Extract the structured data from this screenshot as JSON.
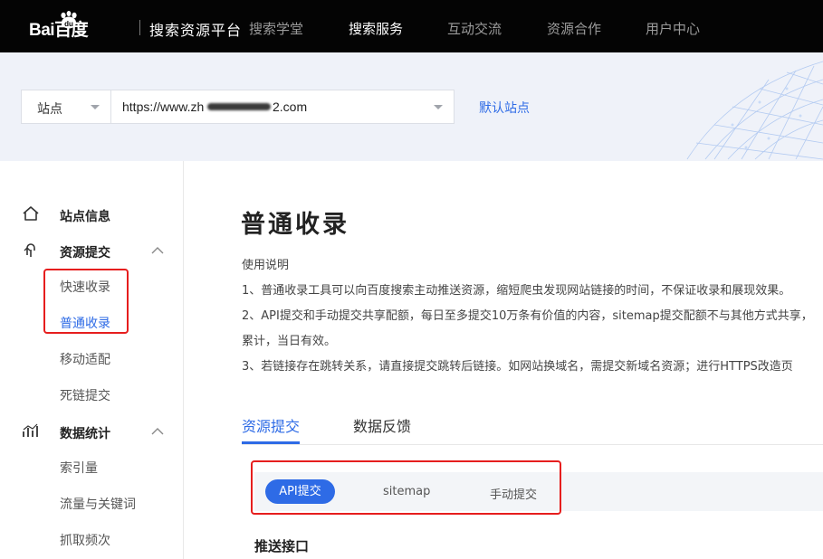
{
  "header": {
    "logo_text": "Bai百度",
    "logo_paw_text": "du",
    "platform_name": "搜索资源平台",
    "nav": [
      {
        "label": "搜索学堂",
        "active": false
      },
      {
        "label": "搜索服务",
        "active": true
      },
      {
        "label": "互动交流",
        "active": false
      },
      {
        "label": "资源合作",
        "active": false
      },
      {
        "label": "用户中心",
        "active": false
      }
    ]
  },
  "site_selector": {
    "type_label": "站点",
    "url_prefix": "https://www.zh",
    "url_suffix": "2.com",
    "default_link": "默认站点"
  },
  "sidebar": {
    "site_info": "站点信息",
    "resource_submit": {
      "label": "资源提交",
      "items": [
        "快速收录",
        "普通收录",
        "移动适配",
        "死链提交"
      ],
      "active_index": 1
    },
    "data_stats": {
      "label": "数据统计",
      "items": [
        "索引量",
        "流量与关键词",
        "抓取频次"
      ]
    }
  },
  "main": {
    "title": "普通收录",
    "usage_heading": "使用说明",
    "usage_lines": [
      "1、普通收录工具可以向百度搜索主动推送资源，缩短爬虫发现网站链接的时间，不保证收录和展现效果。",
      "2、API提交和手动提交共享配额，每日至多提交10万条有价值的内容，sitemap提交配额不与其他方式共享，",
      "累计，当日有效。",
      "3、若链接存在跳转关系，请直接提交跳转后链接。如网站换域名，需提交新域名资源；进行HTTPS改造页"
    ],
    "tabs": [
      "资源提交",
      "数据反馈"
    ],
    "active_tab": 0,
    "subtabs": [
      "API提交",
      "sitemap",
      "手动提交"
    ],
    "active_subtab": 0,
    "section_title": "推送接口"
  },
  "colors": {
    "accent": "#2e6be6",
    "annotation_red": "#e61e1e",
    "topbar": "#040404"
  }
}
